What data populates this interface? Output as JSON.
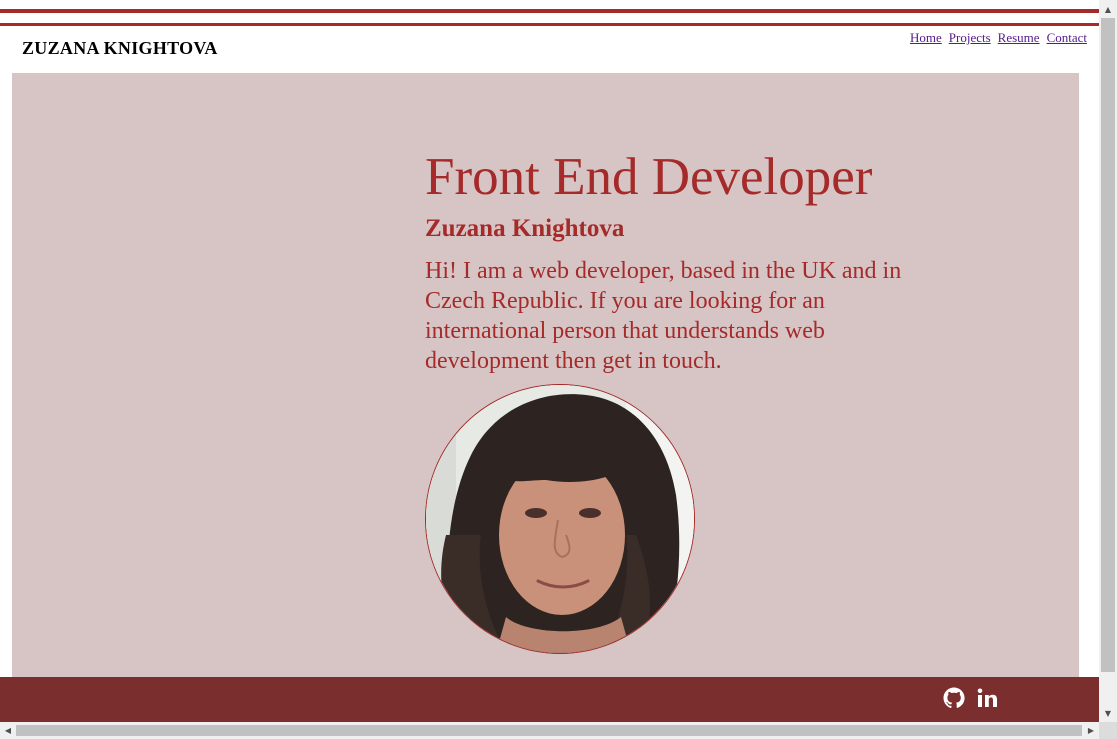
{
  "header": {
    "site_title": "ZUZANA KNIGHTOVA",
    "nav": [
      "Home",
      "Projects",
      "Resume",
      "Contact"
    ]
  },
  "hero": {
    "title": "Front End Developer",
    "name": "Zuzana Knightova",
    "bio": "Hi! I am a web developer, based in the UK and in Czech Republic. If you are looking for an international person that understands web development then get in touch.",
    "portrait_icon": "portrait-photo"
  },
  "footer": {
    "icons": [
      "github-icon",
      "linkedin-icon"
    ]
  },
  "colors": {
    "accent": "#a52a2a",
    "hero_bg": "#d7c5c5",
    "footer_bg": "#7a2e2e",
    "link": "#551a8b"
  }
}
